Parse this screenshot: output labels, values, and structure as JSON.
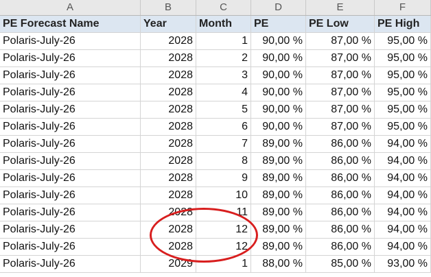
{
  "column_letters": [
    "A",
    "B",
    "C",
    "D",
    "E",
    "F"
  ],
  "header": {
    "name": "PE Forecast Name",
    "year": "Year",
    "month": "Month",
    "pe": "PE",
    "pe_low": "PE Low",
    "pe_high": "PE High"
  },
  "rows": [
    {
      "name": "Polaris-July-26",
      "year": "2028",
      "month": "1",
      "pe": "90,00 %",
      "pe_low": "87,00 %",
      "pe_high": "95,00 %"
    },
    {
      "name": "Polaris-July-26",
      "year": "2028",
      "month": "2",
      "pe": "90,00 %",
      "pe_low": "87,00 %",
      "pe_high": "95,00 %"
    },
    {
      "name": "Polaris-July-26",
      "year": "2028",
      "month": "3",
      "pe": "90,00 %",
      "pe_low": "87,00 %",
      "pe_high": "95,00 %"
    },
    {
      "name": "Polaris-July-26",
      "year": "2028",
      "month": "4",
      "pe": "90,00 %",
      "pe_low": "87,00 %",
      "pe_high": "95,00 %"
    },
    {
      "name": "Polaris-July-26",
      "year": "2028",
      "month": "5",
      "pe": "90,00 %",
      "pe_low": "87,00 %",
      "pe_high": "95,00 %"
    },
    {
      "name": "Polaris-July-26",
      "year": "2028",
      "month": "6",
      "pe": "90,00 %",
      "pe_low": "87,00 %",
      "pe_high": "95,00 %"
    },
    {
      "name": "Polaris-July-26",
      "year": "2028",
      "month": "7",
      "pe": "89,00 %",
      "pe_low": "86,00 %",
      "pe_high": "94,00 %"
    },
    {
      "name": "Polaris-July-26",
      "year": "2028",
      "month": "8",
      "pe": "89,00 %",
      "pe_low": "86,00 %",
      "pe_high": "94,00 %"
    },
    {
      "name": "Polaris-July-26",
      "year": "2028",
      "month": "9",
      "pe": "89,00 %",
      "pe_low": "86,00 %",
      "pe_high": "94,00 %"
    },
    {
      "name": "Polaris-July-26",
      "year": "2028",
      "month": "10",
      "pe": "89,00 %",
      "pe_low": "86,00 %",
      "pe_high": "94,00 %"
    },
    {
      "name": "Polaris-July-26",
      "year": "2028",
      "month": "11",
      "pe": "89,00 %",
      "pe_low": "86,00 %",
      "pe_high": "94,00 %"
    },
    {
      "name": "Polaris-July-26",
      "year": "2028",
      "month": "12",
      "pe": "89,00 %",
      "pe_low": "86,00 %",
      "pe_high": "94,00 %"
    },
    {
      "name": "Polaris-July-26",
      "year": "2028",
      "month": "12",
      "pe": "89,00 %",
      "pe_low": "86,00 %",
      "pe_high": "94,00 %"
    },
    {
      "name": "Polaris-July-26",
      "year": "2029",
      "month": "1",
      "pe": "88,00 %",
      "pe_low": "85,00 %",
      "pe_high": "93,00 %"
    }
  ],
  "annotation": {
    "color": "#d81e1e",
    "shape": "ellipse",
    "highlights": "duplicate Month 12 rows for Year 2028"
  },
  "colors": {
    "header_fill": "#dce6f1",
    "column_header_fill": "#e8e8e8",
    "gridline": "#d4d4d4"
  }
}
